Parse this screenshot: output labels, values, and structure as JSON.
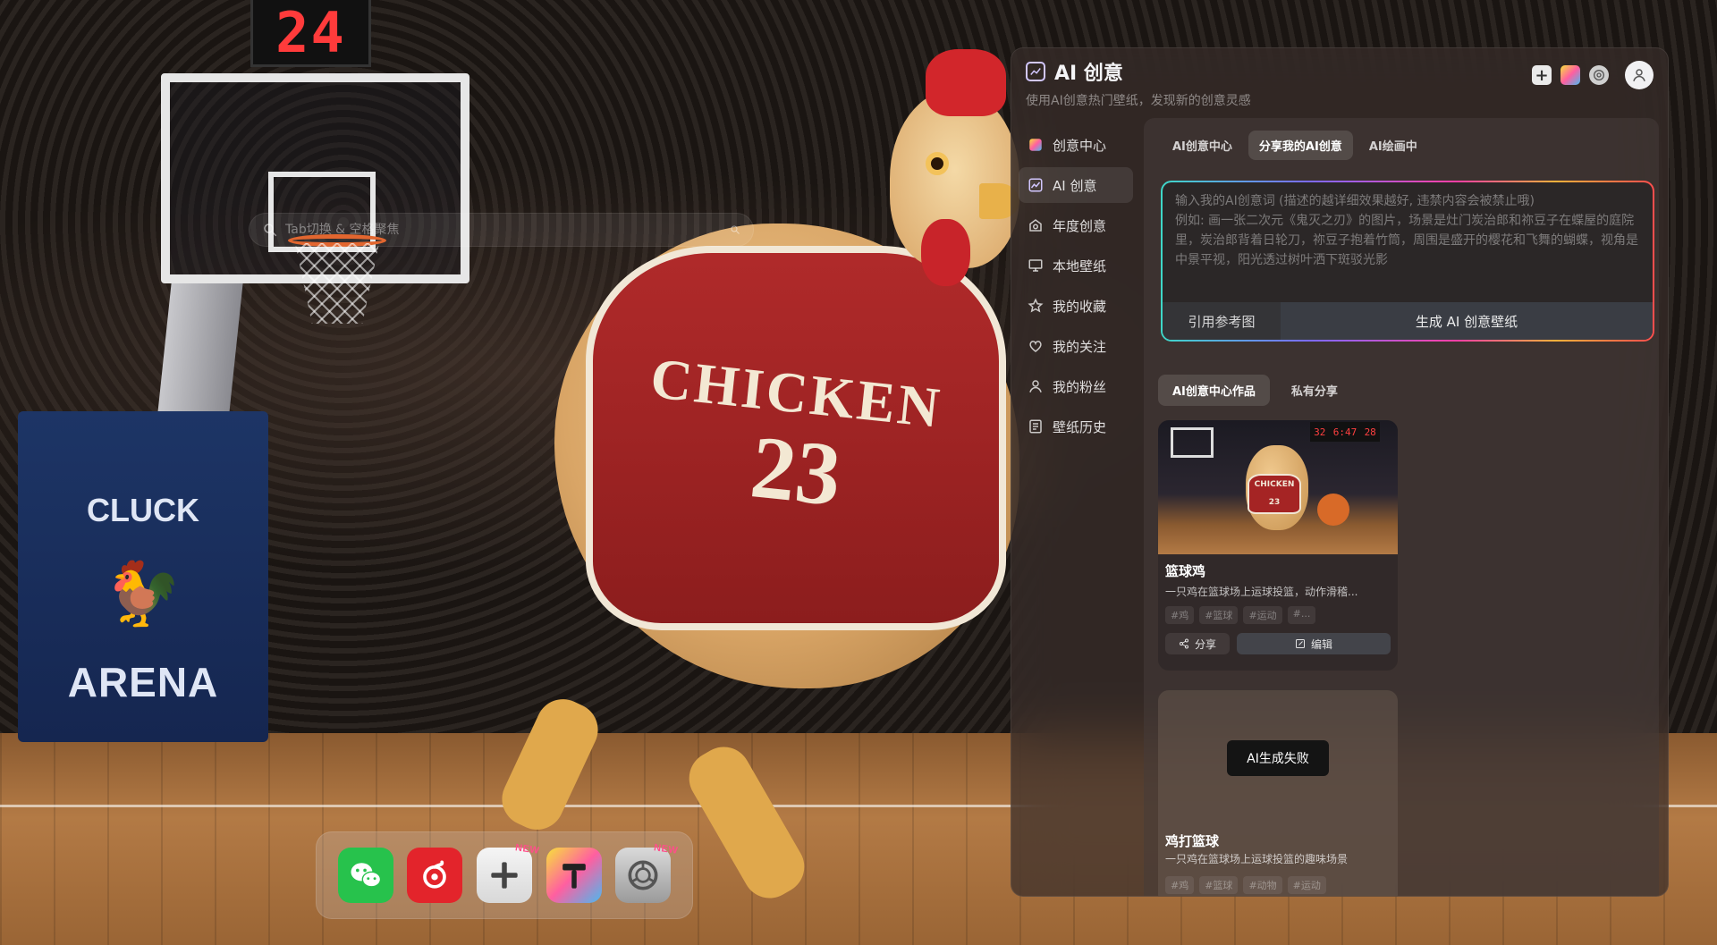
{
  "background": {
    "shot_clock": "24",
    "arena_top": "CLUCK",
    "arena_bottom": "ARENA",
    "jersey_text": "CHICKEN",
    "jersey_number": "23"
  },
  "search": {
    "placeholder": "Tab切换 & 空格聚焦"
  },
  "dock": {
    "apps": [
      {
        "name": "wechat",
        "icon": "wechat-icon",
        "badge": ""
      },
      {
        "name": "netease-music",
        "icon": "netease-music-icon",
        "badge": ""
      },
      {
        "name": "add",
        "icon": "plus-icon",
        "badge": "NEW"
      },
      {
        "name": "painter",
        "icon": "paint-icon",
        "badge": ""
      },
      {
        "name": "settings",
        "icon": "settings-icon",
        "badge": "NEW"
      }
    ]
  },
  "panel": {
    "title": "AI 创意",
    "subtitle": "使用AI创意热门壁纸，发现新的创意灵感",
    "sidebar": {
      "items": [
        {
          "label": "创意中心",
          "icon": "creative-center-icon",
          "active": false
        },
        {
          "label": "AI 创意",
          "icon": "ai-image-icon",
          "active": true
        },
        {
          "label": "年度创意",
          "icon": "annual-icon",
          "active": false
        },
        {
          "label": "本地壁纸",
          "icon": "monitor-icon",
          "active": false
        },
        {
          "label": "我的收藏",
          "icon": "star-icon",
          "active": false
        },
        {
          "label": "我的关注",
          "icon": "heart-icon",
          "active": false
        },
        {
          "label": "我的粉丝",
          "icon": "user-icon",
          "active": false
        },
        {
          "label": "壁纸历史",
          "icon": "history-icon",
          "active": false
        }
      ]
    },
    "tabs": [
      {
        "label": "AI创意中心",
        "active": false
      },
      {
        "label": "分享我的AI创意",
        "active": true
      },
      {
        "label": "AI绘画中",
        "active": false
      }
    ],
    "prompt": {
      "placeholder_line1": "输入我的AI创意词 (描述的越详细效果越好, 违禁内容会被禁止哦)",
      "placeholder_line2": "例如: 画一张二次元《鬼灭之刃》的图片，场景是灶门炭治郎和祢豆子在蝶屋的庭院里，炭治郎背着日轮刀，祢豆子抱着竹筒，周围是盛开的樱花和飞舞的蝴蝶，视角是中景平视，阳光透过树叶洒下斑驳光影",
      "ref_button": "引用参考图",
      "gen_button": "生成 AI 创意壁纸"
    },
    "subtabs": [
      {
        "label": "AI创意中心作品",
        "active": true
      },
      {
        "label": "私有分享",
        "active": false
      }
    ],
    "cards": [
      {
        "title": "篮球鸡",
        "desc": "一只鸡在篮球场上运球投篮，动作滑稽...",
        "tags": [
          "#鸡",
          "#篮球",
          "#运动",
          "#..."
        ],
        "share_label": "分享",
        "edit_label": "编辑",
        "thumb_jersey": "CHICKEN 23",
        "thumb_clock_left": "32",
        "thumb_clock_mid": "6:47",
        "thumb_clock_right": "28"
      },
      {
        "title": "鸡打篮球",
        "desc": "一只鸡在篮球场上运球投篮的趣味场景",
        "tags": [
          "#鸡",
          "#篮球",
          "#动物",
          "#运动"
        ],
        "status": "AI生成失败"
      }
    ]
  }
}
